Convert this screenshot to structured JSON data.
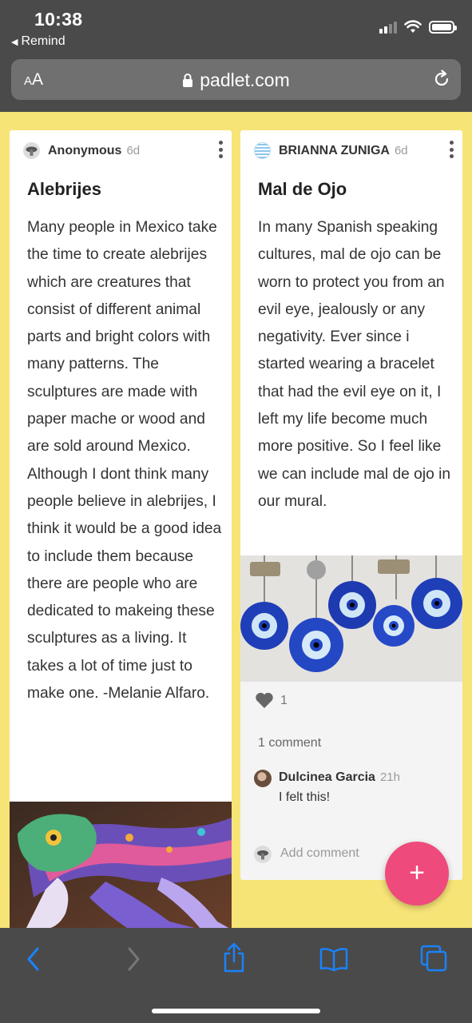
{
  "status_bar": {
    "time": "10:38",
    "back_label": "Remind"
  },
  "browser": {
    "text_size_label": "AA",
    "url": "padlet.com"
  },
  "posts": [
    {
      "author": "Anonymous",
      "age": "6d",
      "title": "Alebrijes",
      "body": "Many people in Mexico take the time to create alebrijes which are creatures that consist of different animal parts and bright colors with many patterns. The sculptures are made with paper mache or wood and are sold around Mexico. Although I dont think many people believe in alebrijes, I think it would be a good idea to include them because there are people who are dedicated to makeing these sculptures as a living. It takes a lot of time just to make one. -Melanie Alfaro.",
      "image": "alebrije-sculpture-photo"
    },
    {
      "author": "BRIANNA ZUNIGA",
      "age": "6d",
      "title": "Mal de Ojo",
      "body": "In many Spanish speaking cultures, mal de ojo can be worn to protect you from an evil eye, jealously or any negativity. Ever since i started wearing a bracelet that had the evil eye on it, I left my life become much more positive. So I feel like we can include mal de ojo in our mural.",
      "image": "evil-eye-charms-photo",
      "likes": "1",
      "comment_count": "1 comment",
      "comments": [
        {
          "author": "Dulcinea Garcia",
          "age": "21h",
          "text": "I felt this!"
        }
      ],
      "add_comment_placeholder": "Add comment"
    }
  ],
  "fab_label": "+",
  "colors": {
    "background": "#f7e477",
    "fab": "#ee4a7c",
    "ios_blue": "#1a82fb",
    "chrome": "#4a4a4a"
  },
  "toolbar_icons": [
    "back-chevron-icon",
    "forward-chevron-icon",
    "share-icon",
    "bookmarks-icon",
    "tabs-icon"
  ]
}
